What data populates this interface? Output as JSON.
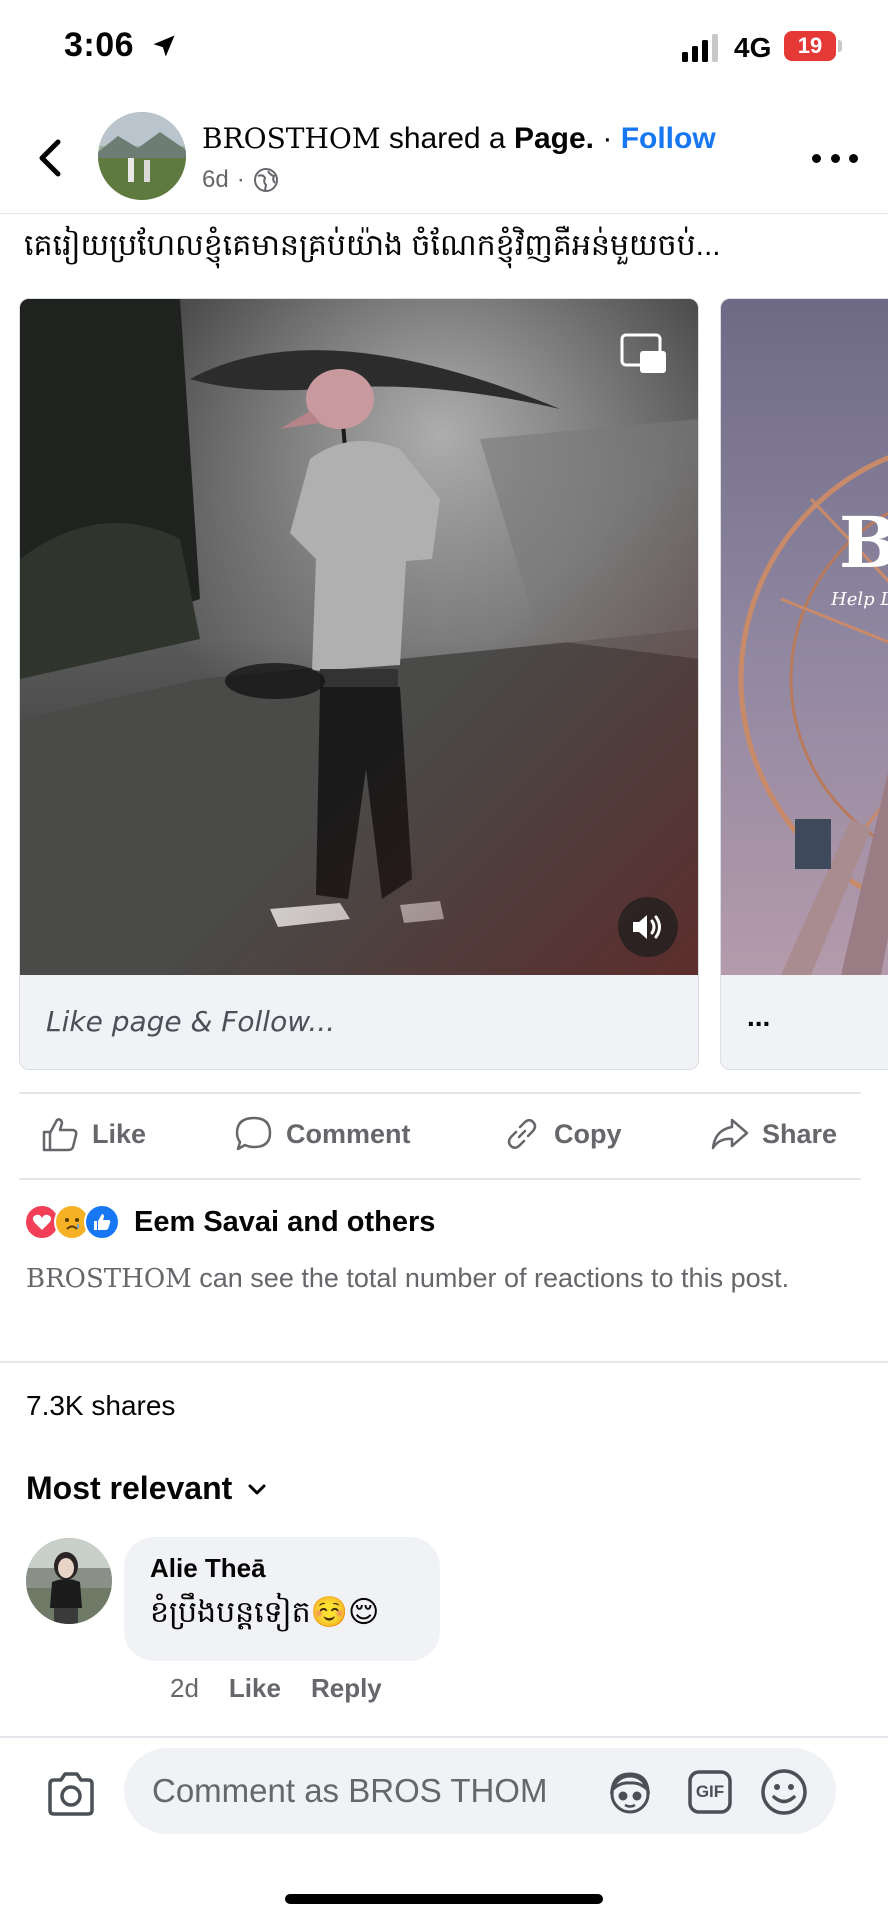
{
  "status_bar": {
    "time": "3:06",
    "network": "4G",
    "battery": "19",
    "battery_color": "#e53935"
  },
  "post": {
    "page_name": "BROSTHOM",
    "shared_text": "shared a",
    "shared_object": "Page.",
    "separator": "·",
    "follow_label": "Follow",
    "age": "6d",
    "age_separator": "·",
    "caption": "គេរៀយប្រហែលខ្ញុំគេមានគ្រប់យ៉ាង ចំណែកខ្ញុំវិញគឺអន់មួយចប់...",
    "card_footer": "Like page & Follow...",
    "side_card_footer": "..."
  },
  "actions": {
    "like": "Like",
    "comment": "Comment",
    "copy": "Copy",
    "share": "Share"
  },
  "reactions": {
    "summary": "Eem Savai and others",
    "note_name": "BROSTHOM",
    "note_rest": " can see the total number of reactions to this post.",
    "types": [
      "love",
      "sad",
      "like"
    ]
  },
  "shares": "7.3K shares",
  "sort": {
    "label": "Most relevant"
  },
  "comment": {
    "author": "Alie Theā",
    "text": "ខំប្រឹងបន្តទៀត☺️😌",
    "age": "2d",
    "like": "Like",
    "reply": "Reply"
  },
  "composer": {
    "placeholder": "Comment as BROS THOM",
    "gif_label": "GIF"
  },
  "colors": {
    "accent": "#1877f2",
    "secondary_text": "#65676b",
    "bubble": "#f0f2f5"
  }
}
